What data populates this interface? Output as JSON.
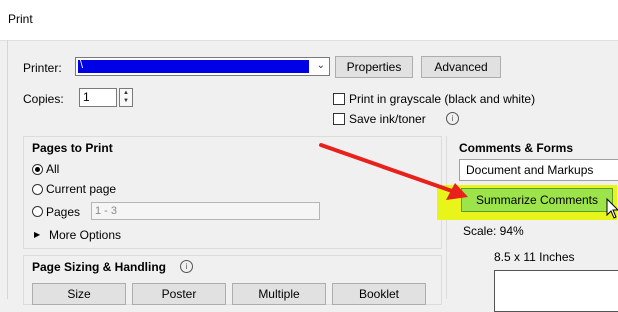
{
  "window": {
    "title": "Print"
  },
  "printer": {
    "label": "Printer:",
    "selected": "\\"
  },
  "buttons": {
    "properties": "Properties",
    "advanced": "Advanced"
  },
  "copies": {
    "label": "Copies:",
    "value": "1"
  },
  "options": {
    "grayscale": "Print in grayscale (black and white)",
    "save_ink": "Save ink/toner",
    "info": "i"
  },
  "pages_to_print": {
    "title": "Pages to Print",
    "all": "All",
    "current": "Current page",
    "pages": "Pages",
    "pages_value": "1 - 3",
    "more": "More Options"
  },
  "comments_forms": {
    "title": "Comments & Forms",
    "selected": "Document and Markups",
    "summarize": "Summarize Comments"
  },
  "preview": {
    "scale": "Scale:  94%",
    "paper": "8.5 x 11 Inches"
  },
  "sizing": {
    "title": "Page Sizing & Handling",
    "tabs": [
      "Size",
      "Poster",
      "Multiple",
      "Booklet"
    ]
  },
  "colors": {
    "highlight": "#e7f51b",
    "summarize_btn": "#9de34a",
    "arrow": "#e8211c",
    "selection": "#0000e6"
  }
}
